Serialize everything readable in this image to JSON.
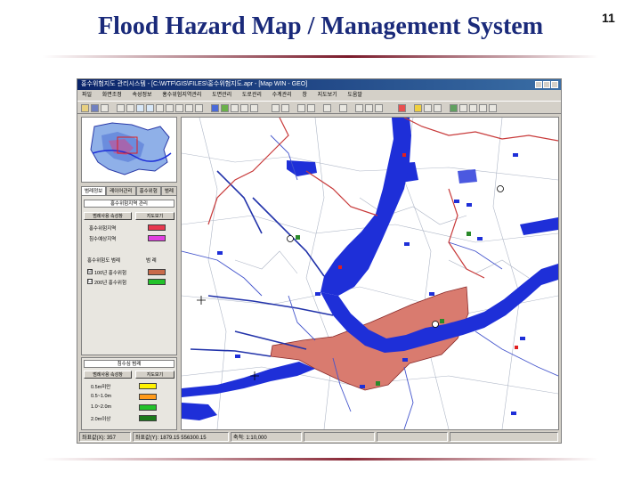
{
  "slide": {
    "title": "Flood Hazard Map / Management System",
    "page_number": "11"
  },
  "app": {
    "window_title": "홍수위험지도 관리시스템 - [C:\\WTF\\GIS\\FILES\\홍수위험지도.apr - [Map WIN - GEO]",
    "menu": [
      "파일",
      "화면조정",
      "속성정보",
      "홍수위험지역관리",
      "도면관리",
      "도로관리",
      "수계관리",
      "창",
      "지도보기",
      "도움말"
    ],
    "tabs": [
      "범례정보",
      "레이어관리",
      "홍수위험",
      "범례"
    ],
    "panel_top": {
      "header": "홍수위험지역 관리",
      "buttons": [
        "범례사용 속성창",
        "지도보기"
      ],
      "legend": [
        {
          "label": "홍수위험지역",
          "color": "#e8384f"
        },
        {
          "label": "침수예상지역",
          "color": "#e040e0"
        }
      ],
      "section_left": "홍수위험도 범례",
      "section_right": "범 례",
      "checks": [
        {
          "label": "100년 홍수위험",
          "checked": "☑",
          "color": "#c86a4a"
        },
        {
          "label": "200년 홍수위험",
          "checked": "☐",
          "color": "#22c22a"
        }
      ]
    },
    "panel_bottom": {
      "header": "침수심 범례",
      "buttons": [
        "범례사용 속성창",
        "지도보기"
      ],
      "legend": [
        {
          "label": "0.5m미만",
          "color": "#fff200"
        },
        {
          "label": "0.5~1.0m",
          "color": "#ff9a1a"
        },
        {
          "label": "1.0~2.0m",
          "color": "#22c22a"
        },
        {
          "label": "2.0m이상",
          "color": "#1a7a1a"
        }
      ]
    },
    "status": [
      "좌표값(X): 357",
      "좌표값(Y): 1879.15  556300.15",
      "축척: 1:10,000"
    ],
    "colors": {
      "river": "#1e2fd8",
      "hazard_zone": "#d97b6f",
      "road": "#2233aa",
      "admin_boundary": "#c83a3a"
    }
  }
}
